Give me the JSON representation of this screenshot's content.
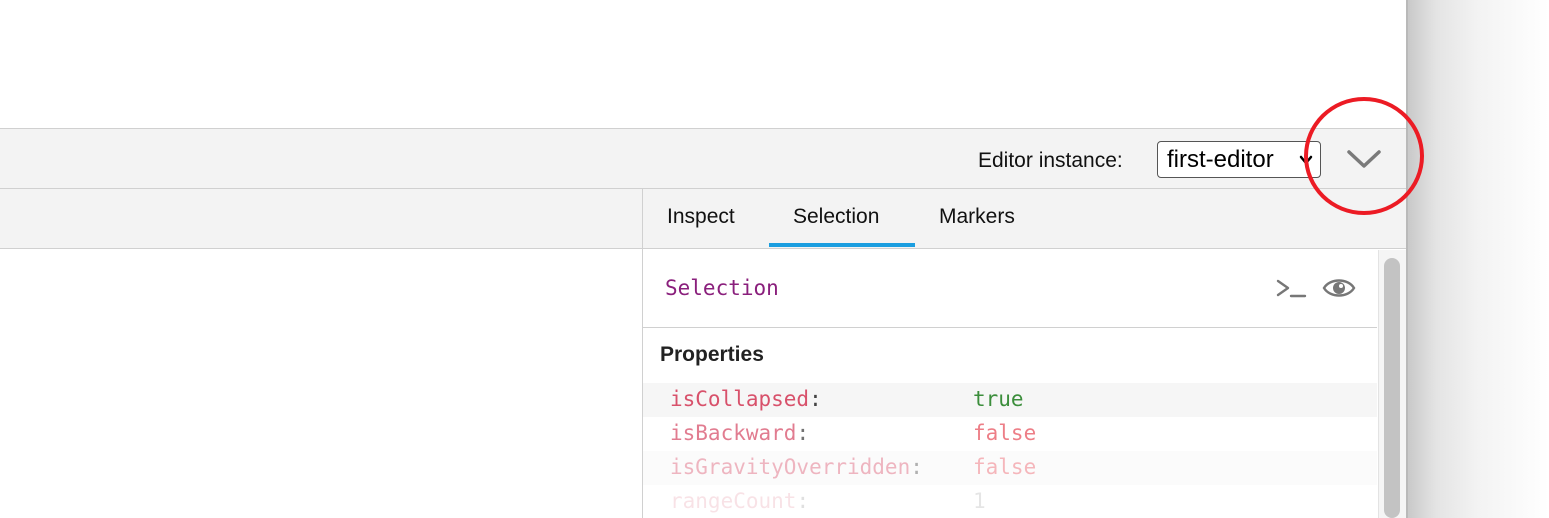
{
  "header": {
    "editor_instance_label": "Editor instance:",
    "editor_instance_value": "first-editor"
  },
  "tabs": [
    {
      "label": "Inspect",
      "active": false
    },
    {
      "label": "Selection",
      "active": true
    },
    {
      "label": "Markers",
      "active": false
    }
  ],
  "selection_panel": {
    "title": "Selection",
    "log_icon": "terminal-icon",
    "show_icon": "eye-icon"
  },
  "properties": {
    "heading": "Properties",
    "rows": [
      {
        "key": "isCollapsed",
        "value": "true"
      },
      {
        "key": "isBackward",
        "value": "false"
      },
      {
        "key": "isGravityOverridden",
        "value": "false"
      },
      {
        "key": "rangeCount",
        "value": "1"
      }
    ]
  },
  "colors": {
    "accent_tab_underline": "#1b9ee0",
    "annotation_circle": "#ec1b24",
    "property_key": "#d8516b",
    "value_true": "#3c8e3c",
    "value_false": "#e8545f",
    "class_name": "#8a1f7c"
  }
}
